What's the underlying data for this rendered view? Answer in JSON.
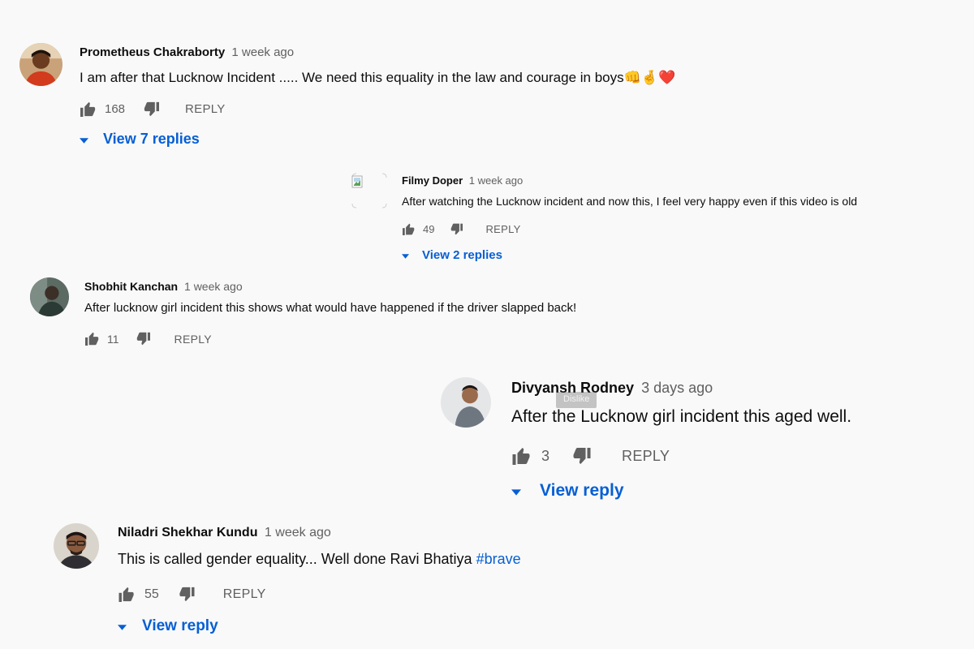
{
  "comments": [
    {
      "author": "Prometheus Chakraborty",
      "time": "1 week ago",
      "text": "I am after that Lucknow Incident ..... We need this equality in the law and courage in boys",
      "emoji": "👊🤞❤️",
      "likes": "168",
      "reply_label": "REPLY",
      "view_replies": "View 7 replies"
    },
    {
      "author": "Filmy Doper",
      "time": "1 week ago",
      "text": "After watching the Lucknow incident and now this, I feel very happy even if this video is old",
      "likes": "49",
      "reply_label": "REPLY",
      "view_replies": "View 2 replies"
    },
    {
      "author": "Shobhit Kanchan",
      "time": "1 week ago",
      "text": "After lucknow girl incident this shows what would have happened if the driver slapped back!",
      "likes": "11",
      "reply_label": "REPLY"
    },
    {
      "author": "Divyansh Rodney",
      "time": "3 days ago",
      "text": "After the Lucknow girl incident this aged well.",
      "likes": "3",
      "reply_label": "REPLY",
      "view_replies": "View reply",
      "tooltip": "Dislike"
    },
    {
      "author": "Niladri Shekhar Kundu",
      "time": "1 week ago",
      "text": "This is called gender equality... Well done Ravi Bhatiya ",
      "hashtag": "#brave",
      "likes": "55",
      "reply_label": "REPLY",
      "view_replies": "View reply"
    }
  ],
  "icons": {
    "like": "thumbs-up-icon",
    "dislike": "thumbs-down-icon",
    "expand": "caret-down-icon"
  },
  "colors": {
    "background": "#f9f9f9",
    "link": "#065fd4",
    "secondary": "#606060"
  }
}
